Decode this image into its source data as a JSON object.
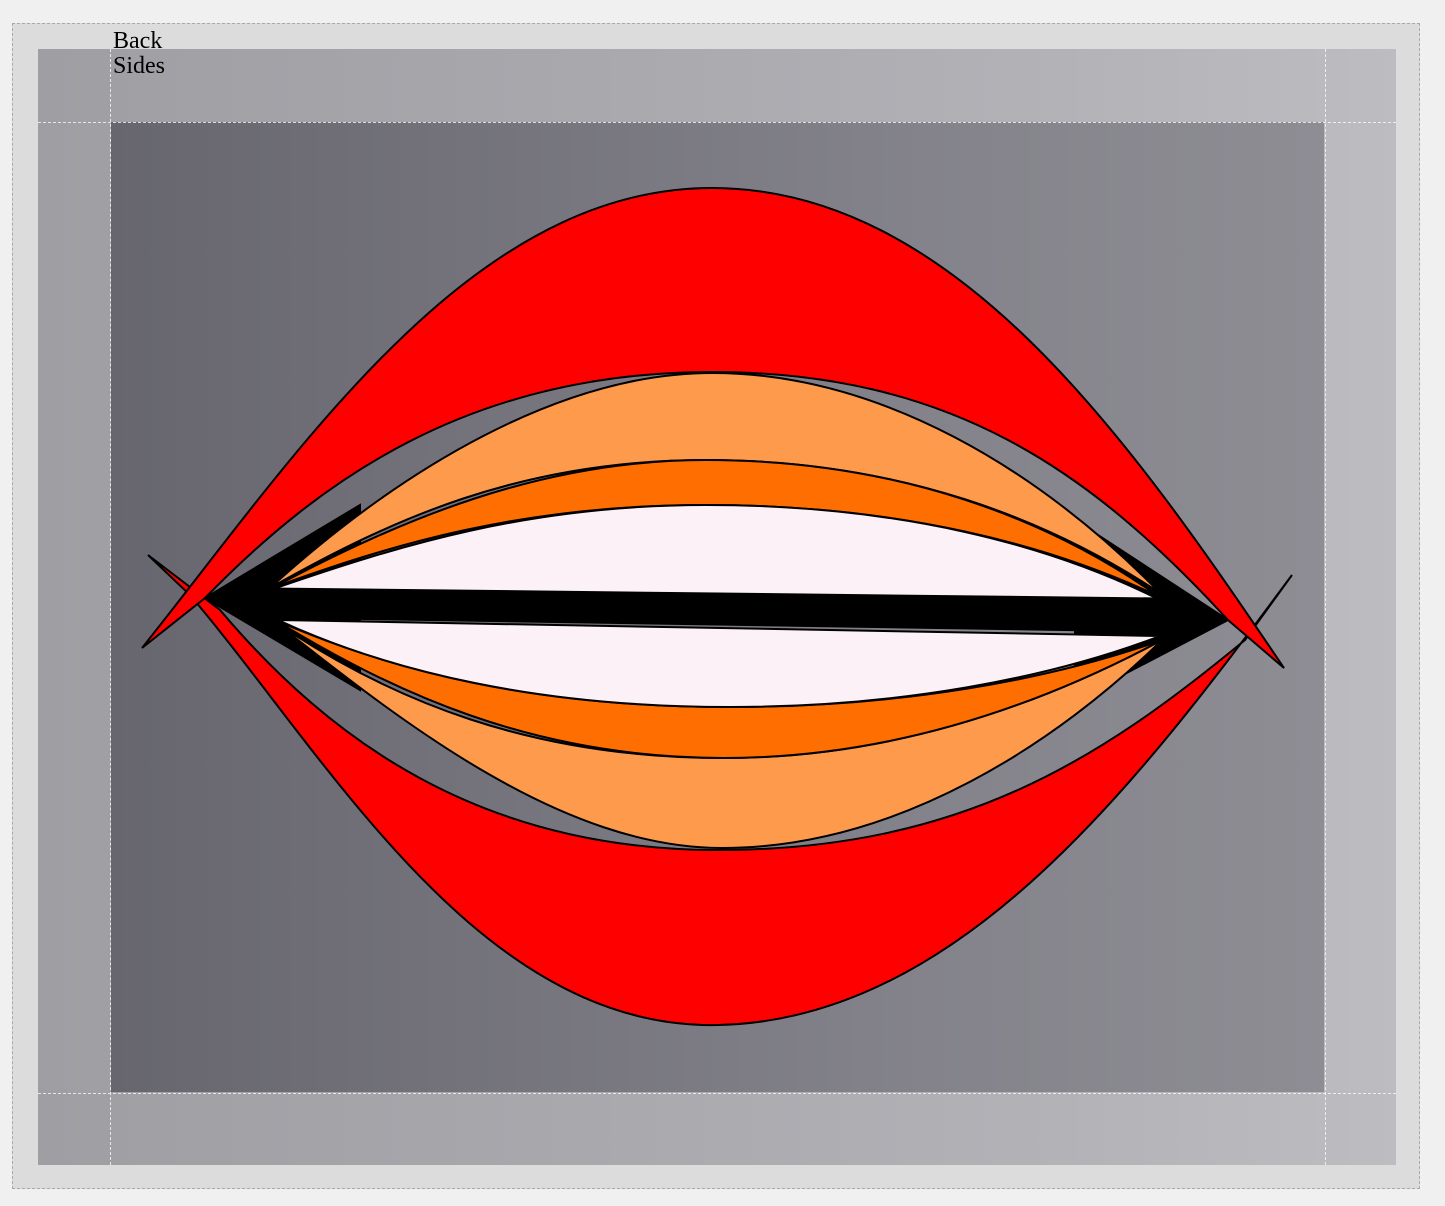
{
  "labels": {
    "back": "Back",
    "sides": "Sides"
  },
  "colors": {
    "outer_lip": "#ff0000",
    "middle_band": "#fe9a4b",
    "inner_band": "#ff6e00",
    "teeth": "#fcf1f7",
    "mouth_line": "#000000",
    "sides_gradient_start": "#67666e",
    "sides_gradient_end": "#8e8d94",
    "back_gradient_start": "#9e9ea3",
    "back_gradient_end": "#bcbcc1"
  }
}
